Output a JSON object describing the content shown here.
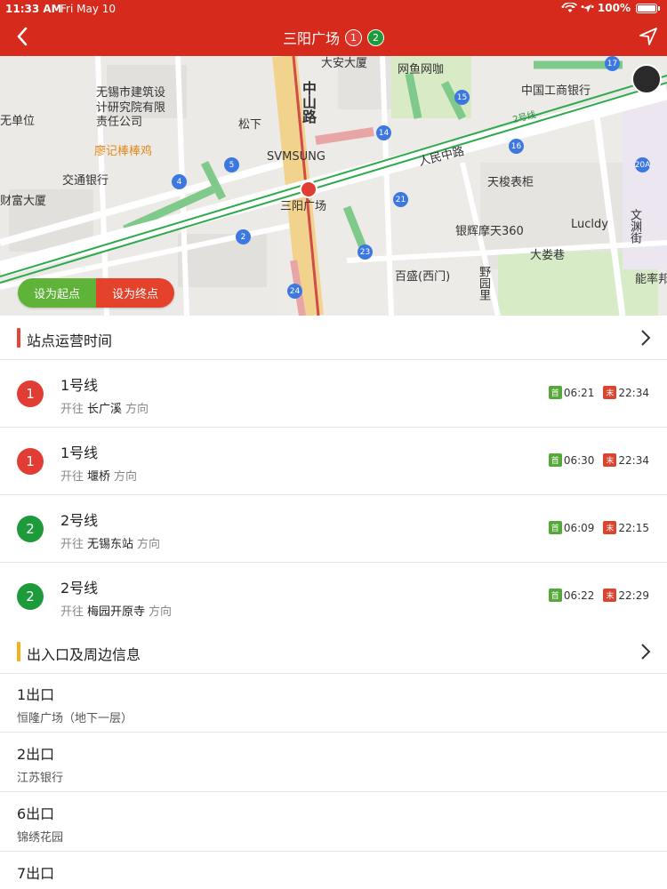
{
  "status": {
    "time": "11:33 AM",
    "date": "Fri May 10",
    "battery": "100%"
  },
  "nav": {
    "title": "三阳广场",
    "badges": [
      {
        "label": "1",
        "color": "#e23d35"
      },
      {
        "label": "2",
        "color": "#1d9a3a"
      }
    ]
  },
  "map": {
    "labels": {
      "jianzhu": "无锡市建筑设",
      "jianzhu2": "计研究院有限",
      "jianzhu3": "责任公司",
      "yuanwei": "无单位",
      "songxia": "松下",
      "wangyu": "网鱼网咖",
      "daan": "大安大厦",
      "zhongshan": "中山路",
      "gonghang": "中国工商银行",
      "liaoji": "廖记棒棒鸡",
      "jiaotong": "交通银行",
      "caifu": "财富大厦",
      "samsung": "SVMSUNG",
      "renmin": "人民中路",
      "tianxiao": "天梭表柜",
      "sanyang": "三阳广场",
      "yinhui": "银辉摩天360",
      "lucldy": "Lucldy",
      "dalou": "大娄巷",
      "baisheng": "百盛(西门)",
      "yeyuanli": "野园里",
      "wenyuanjie": "文渊街",
      "neng": "能率邦",
      "line2": "2号线"
    },
    "set_start": "设为起点",
    "set_end": "设为终点"
  },
  "operation": {
    "title": "站点运营时间",
    "bar_color": "#e2453a",
    "first_tag": "首",
    "last_tag": "末",
    "direction_prefix": "开往",
    "direction_suffix": "方向",
    "lines": [
      {
        "badge": "1",
        "name": "1号线",
        "destination": "长广溪",
        "first": "06:21",
        "last": "22:34",
        "color": "#e23d35"
      },
      {
        "badge": "1",
        "name": "1号线",
        "destination": "堰桥",
        "first": "06:30",
        "last": "22:34",
        "color": "#e23d35"
      },
      {
        "badge": "2",
        "name": "2号线",
        "destination": "无锡东站",
        "first": "06:09",
        "last": "22:15",
        "color": "#1d9a3a"
      },
      {
        "badge": "2",
        "name": "2号线",
        "destination": "梅园开原寺",
        "first": "06:22",
        "last": "22:29",
        "color": "#1d9a3a"
      }
    ]
  },
  "exits": {
    "title": "出入口及周边信息",
    "bar_color": "#f2b21a",
    "items": [
      {
        "name": "1出口",
        "desc": "恒隆广场（地下一层）"
      },
      {
        "name": "2出口",
        "desc": "江苏银行"
      },
      {
        "name": "6出口",
        "desc": "锦绣花园"
      },
      {
        "name": "7出口",
        "desc": ""
      }
    ]
  }
}
